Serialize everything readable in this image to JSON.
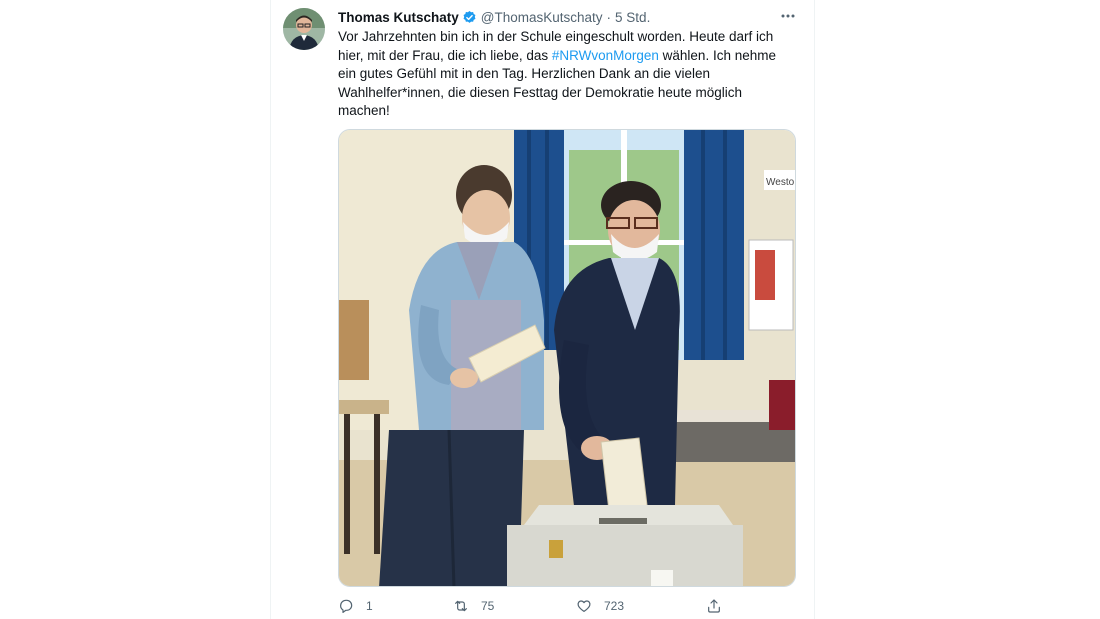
{
  "tweet": {
    "author_name": "Thomas Kutschaty",
    "handle": "@ThomasKutschaty",
    "separator": "·",
    "time": "5 Std.",
    "more_label": "•••",
    "text_part1": "Vor Jahrzehnten bin ich in der Schule eingeschult worden. Heute darf ich hier, mit der Frau, die ich liebe, das ",
    "hashtag": "#NRWvonMorgen",
    "text_part2": " wählen. Ich nehme ein gutes Gefühl mit in den Tag. Herzlichen Dank an die vielen Wahlhelfer*innen, die diesen Festtag der Demokratie heute möglich machen!",
    "photo_sign_text": "Westo",
    "replies": "1",
    "retweets": "75",
    "likes": "723"
  },
  "icons": {
    "verified": "verified-badge-icon",
    "reply": "reply-icon",
    "retweet": "retweet-icon",
    "like": "heart-icon",
    "share": "share-icon",
    "more": "more-icon"
  },
  "colors": {
    "accent": "#1d9bf0",
    "text": "#0f1419",
    "secondary": "#536471"
  }
}
